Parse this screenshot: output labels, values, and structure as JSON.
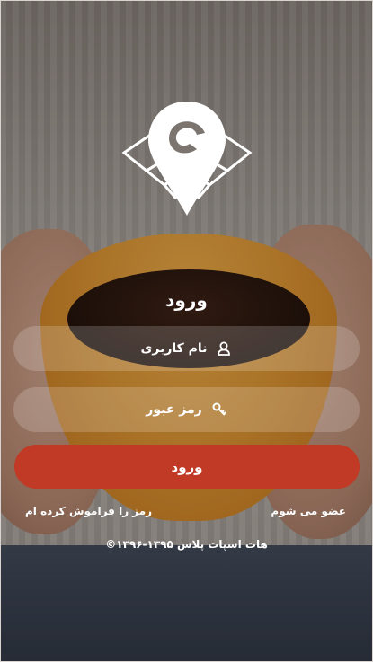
{
  "login": {
    "title": "ورود",
    "username_placeholder": "نام کاربری",
    "password_placeholder": "رمز عبور",
    "submit_label": "ورود",
    "forgot_password_link": "رمز را فراموش کرده ام",
    "register_link": "عضو می شوم"
  },
  "footer": {
    "copyright": "©۱۳۹۶-۱۳۹۵ هات اسپات پلاس"
  },
  "icons": {
    "logo": "location-wifi-logo",
    "username": "user-icon",
    "password": "key-icon"
  },
  "colors": {
    "accent": "#c03a26"
  }
}
